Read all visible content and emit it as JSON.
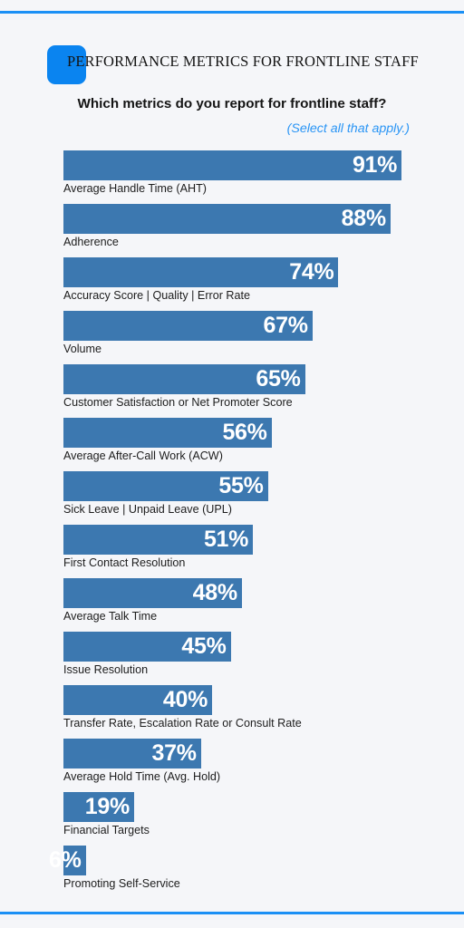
{
  "header": {
    "badge_color": "#0a84f0",
    "title": "PERFORMANCE METRICS FOR FRONTLINE STAFF"
  },
  "accent": {
    "rule_color": "#1b90f5",
    "background_color": "#f5f6f9",
    "bar_color": "#3c78b0",
    "subnote_color": "#2a95f5"
  },
  "question": {
    "text": "Which metrics do you report for frontline staff?",
    "subnote": "(Select all that apply.)"
  },
  "chart_data": {
    "type": "bar",
    "title": "Which metrics do you report for frontline staff?",
    "subtitle": "(Select all that apply.)",
    "orientation": "horizontal",
    "xlabel": "",
    "ylabel": "",
    "xlim": [
      0,
      100
    ],
    "grid": false,
    "legend": "none",
    "value_suffix": "%",
    "categories": [
      "Average Handle Time (AHT)",
      "Adherence",
      "Accuracy Score | Quality | Error Rate",
      "Volume",
      "Customer Satisfaction or Net Promoter Score",
      "Average After-Call Work (ACW)",
      "Sick Leave | Unpaid Leave (UPL)",
      "First Contact Resolution",
      "Average Talk Time",
      "Issue Resolution",
      "Transfer Rate, Escalation Rate or Consult Rate",
      "Average Hold Time (Avg. Hold)",
      "Financial Targets",
      "Promoting Self-Service"
    ],
    "values": [
      91,
      88,
      74,
      67,
      65,
      56,
      55,
      51,
      48,
      45,
      40,
      37,
      19,
      6
    ],
    "value_labels": [
      "91%",
      "88%",
      "74%",
      "67%",
      "65%",
      "56%",
      "55%",
      "51%",
      "48%",
      "45%",
      "40%",
      "37%",
      "19%",
      "6%"
    ]
  }
}
